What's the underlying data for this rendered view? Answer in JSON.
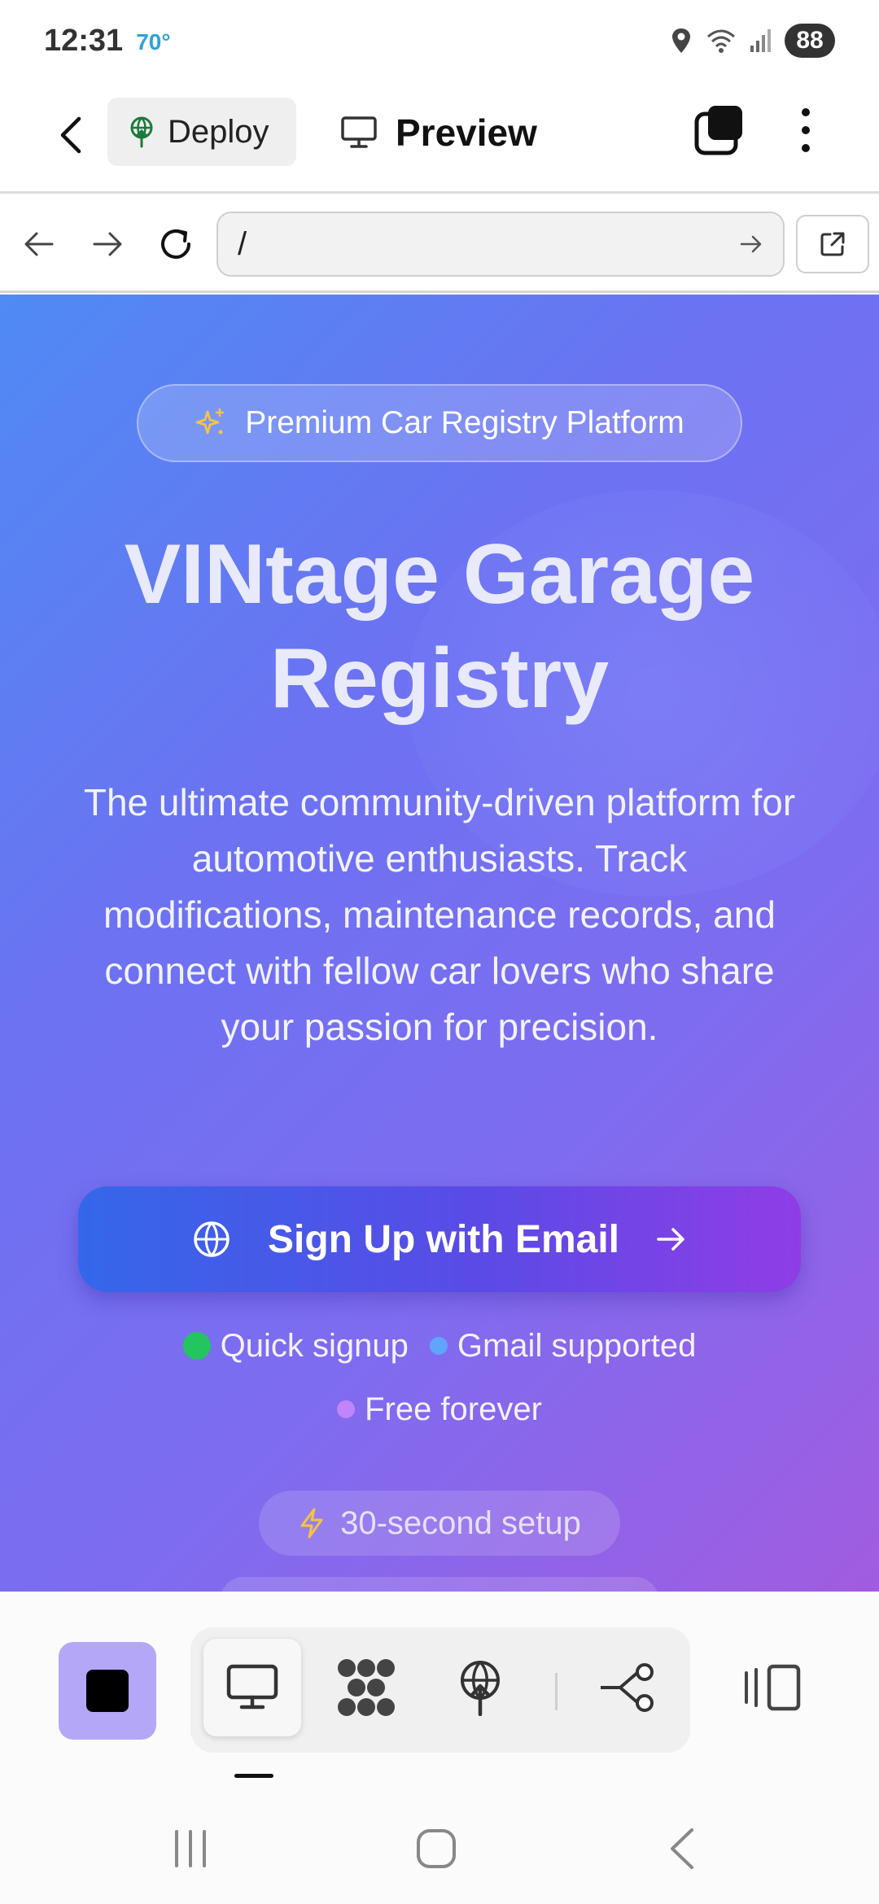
{
  "status_bar": {
    "time": "12:31",
    "temperature": "70°",
    "battery": "88"
  },
  "header": {
    "deploy_label": "Deploy",
    "preview_label": "Preview"
  },
  "browser": {
    "url": "/"
  },
  "hero": {
    "badge": "Premium Car Registry Platform",
    "title_line1": "VINtage Garage",
    "title_line2": "Registry",
    "description": "The ultimate community-driven platform for automotive enthusiasts. Track modifications, maintenance records, and connect with fellow car lovers who share your passion for precision.",
    "cta_label": "Sign Up with Email",
    "features": [
      {
        "label": "Quick signup",
        "color": "#22c55e"
      },
      {
        "label": "Gmail supported",
        "color": "#60a5fa"
      },
      {
        "label": "Free forever",
        "color": "#c084fc"
      }
    ],
    "setup_label": "30-second setup"
  },
  "colors": {
    "accent": "#6c72f2",
    "stop_button": "#b4a7f7",
    "cta_start": "#3467ea",
    "cta_end": "#8f3de6"
  },
  "toolbar": {
    "tools": [
      "monitor-icon",
      "grid-blob-icon",
      "deploy-icon",
      "workflow-icon"
    ],
    "active_tool": "monitor-icon"
  }
}
